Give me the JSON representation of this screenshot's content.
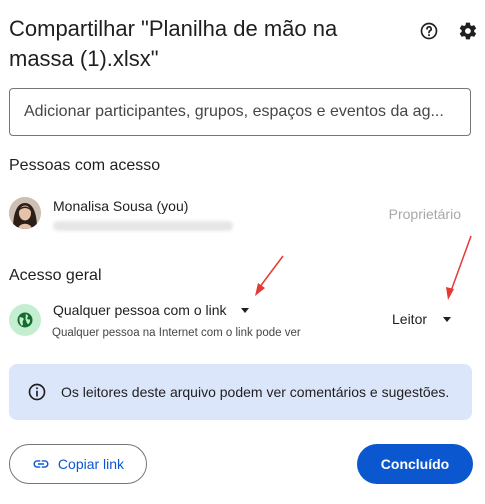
{
  "dialog": {
    "title": "Compartilhar \"Planilha de mão na massa (1).xlsx\"",
    "help_icon": "help-circle-icon",
    "settings_icon": "gear-icon"
  },
  "add_people": {
    "placeholder": "Adicionar participantes, grupos, espaços e eventos da ag..."
  },
  "people_with_access": {
    "heading": "Pessoas com acesso",
    "people": [
      {
        "name": "Monalisa Sousa (you)",
        "email": "",
        "role": "Proprietário"
      }
    ]
  },
  "general_access": {
    "heading": "Acesso geral",
    "icon": "globe-icon",
    "scope_label": "Qualquer pessoa com o link",
    "scope_description": "Qualquer pessoa na Internet com o link pode ver",
    "role_label": "Leitor"
  },
  "info_banner": {
    "icon": "info-icon",
    "text": "Os leitores deste arquivo podem ver comentários e sugestões."
  },
  "footer": {
    "copy_link_label": "Copiar link",
    "copy_link_icon": "link-icon",
    "done_label": "Concluído"
  },
  "colors": {
    "accent": "#0b57d0",
    "banner_bg": "#dbe6fb",
    "globe_bg": "#c4eed0",
    "annotation_arrow": "#e53935"
  }
}
